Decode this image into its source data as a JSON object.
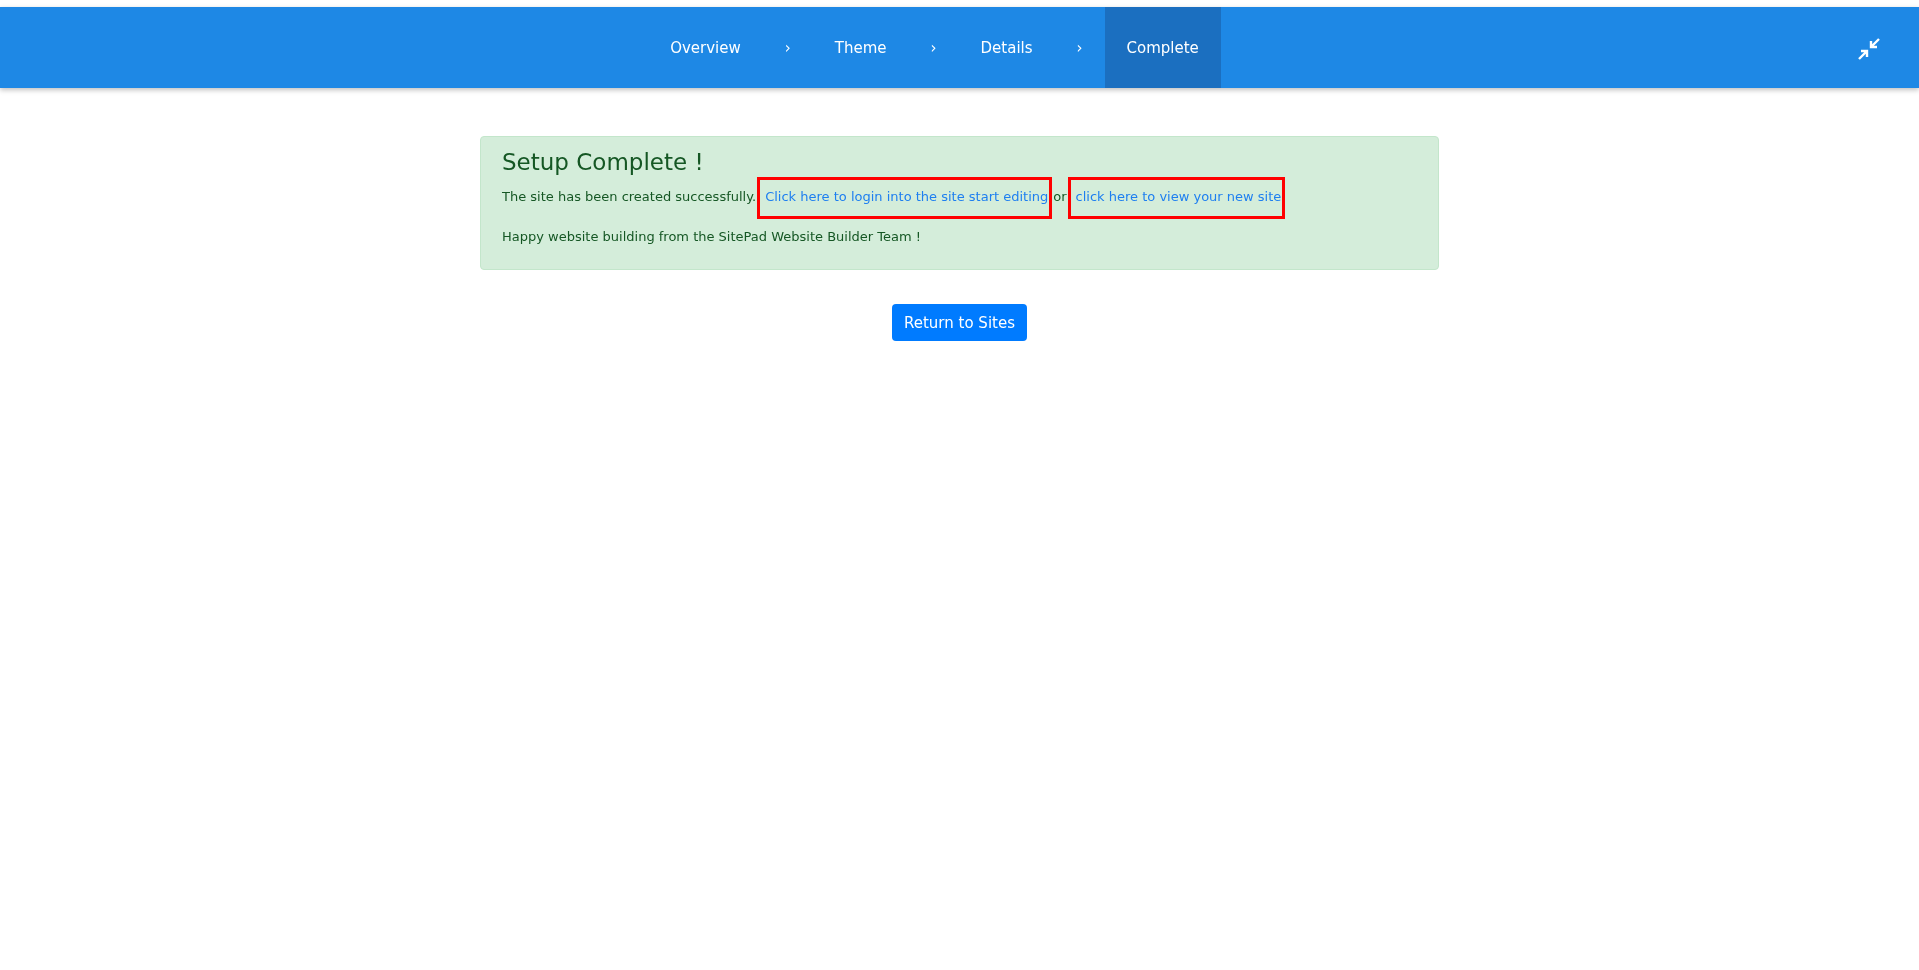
{
  "wizard_steps": [
    {
      "label": "Overview",
      "selected": false,
      "separator": "›"
    },
    {
      "label": "Theme",
      "selected": false,
      "separator": "›"
    },
    {
      "label": "Details",
      "selected": false,
      "separator": "›"
    },
    {
      "label": "Complete",
      "selected": true
    }
  ],
  "alert": {
    "title": "Setup Complete !",
    "message_start": "The site has been created successfully.",
    "links": [
      {
        "text": "Click here to login into the site start editing",
        "highlighted": true
      },
      {
        "text": "click here to view your new site",
        "highlighted": true
      }
    ],
    "joiner": "or",
    "closing": "Happy website building from the SitePad Website Builder Team !"
  },
  "return_button": "Return to Sites"
}
